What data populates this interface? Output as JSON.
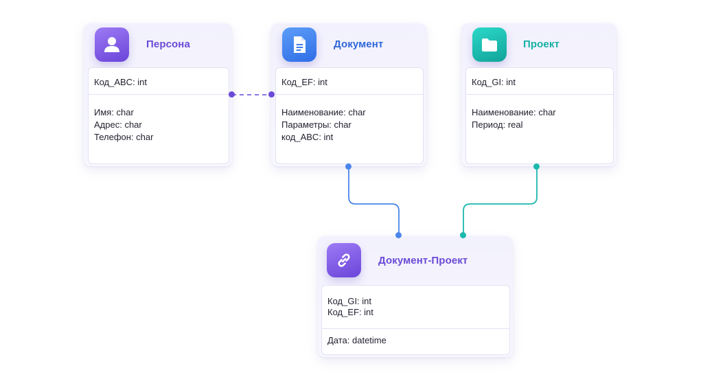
{
  "entities": {
    "person": {
      "title": "Персона",
      "icon": "person-icon",
      "key_fields": [
        "Код_ABC: int"
      ],
      "fields": [
        "Имя: char",
        "Адрес: char",
        "Телефон: char"
      ]
    },
    "document": {
      "title": "Документ",
      "icon": "document-icon",
      "key_fields": [
        "Код_EF: int"
      ],
      "fields": [
        "Наименование: char",
        "Параметры: char",
        "код_ABC: int"
      ]
    },
    "project": {
      "title": "Проект",
      "icon": "folder-icon",
      "key_fields": [
        "Код_GI: int"
      ],
      "fields": [
        "Наименование: char",
        "Период: real"
      ]
    },
    "document_project": {
      "title": "Документ-Проект",
      "icon": "link-icon",
      "key_fields": [
        "Код_GI: int",
        "Код_EF: int"
      ],
      "fields": [
        "Дата: datetime"
      ]
    }
  },
  "colors": {
    "purple": "#6a4ad6",
    "blue": "#4a86ea",
    "teal": "#1bb8ad",
    "dashed_link": "#7b5ee0"
  }
}
